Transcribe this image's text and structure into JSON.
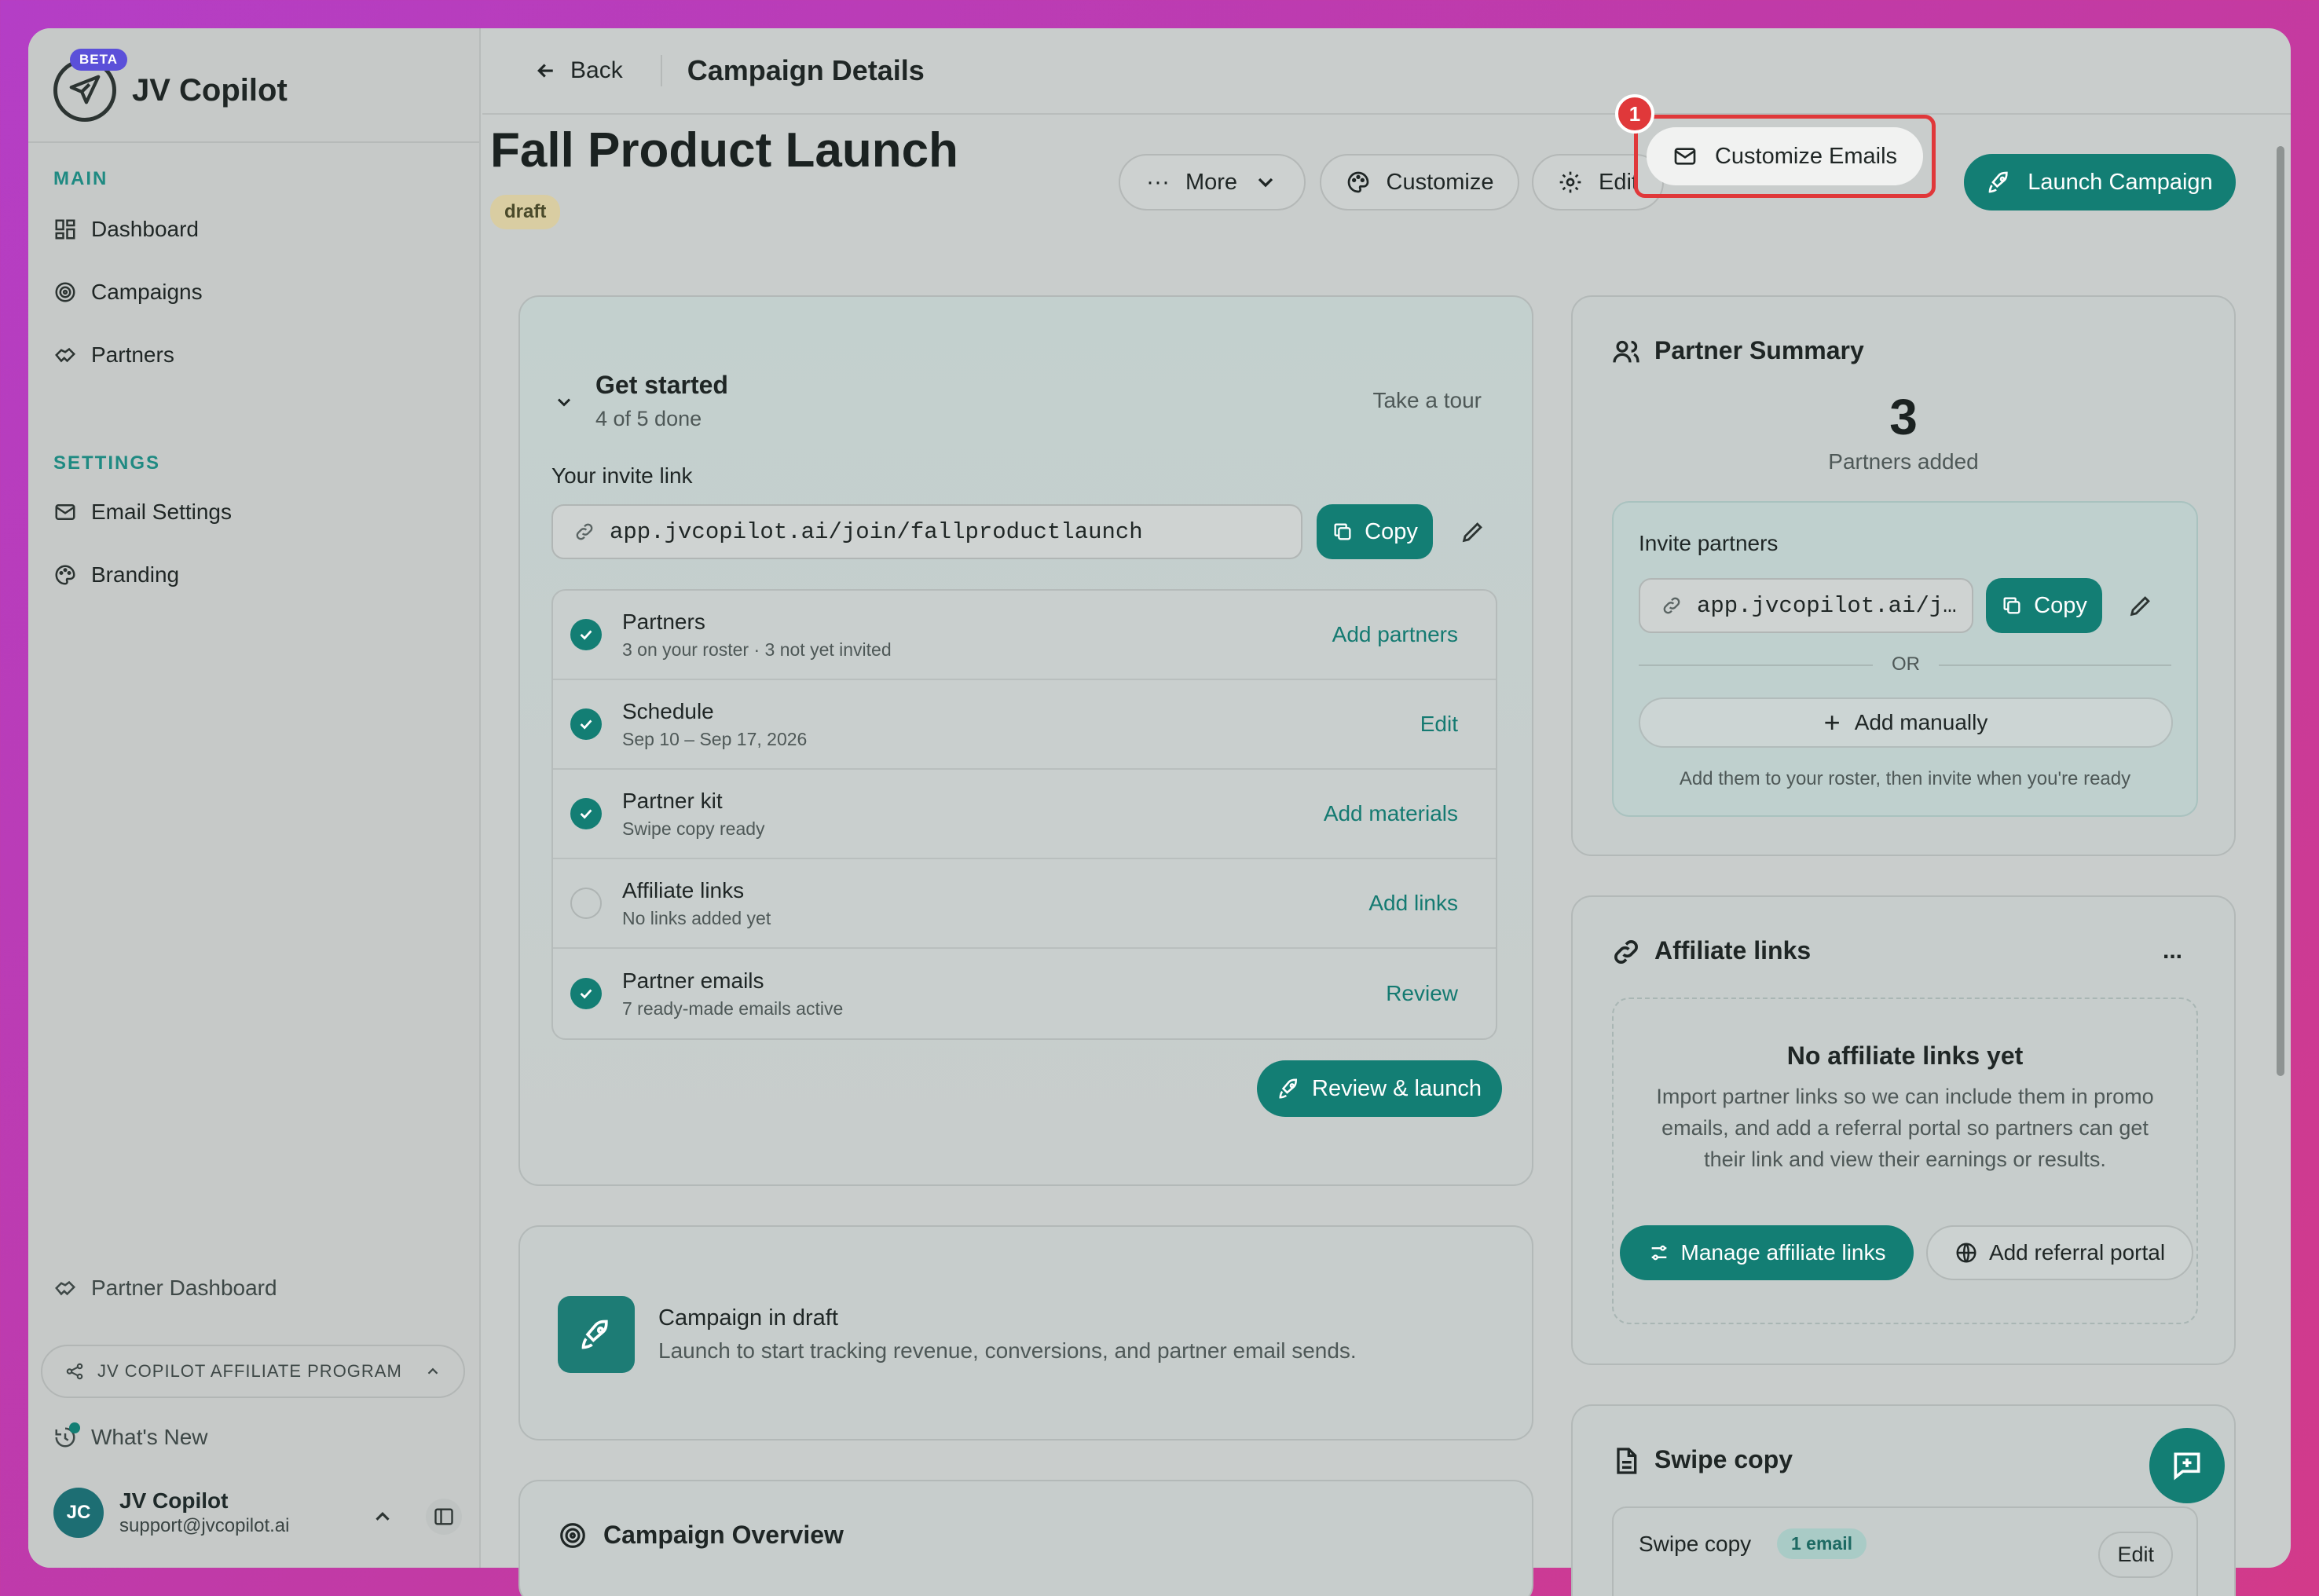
{
  "app": {
    "name": "JV Copilot",
    "beta": "BETA"
  },
  "sidebar": {
    "main_heading": "MAIN",
    "main_items": [
      {
        "label": "Dashboard",
        "icon": "dashboard-icon"
      },
      {
        "label": "Campaigns",
        "icon": "target-icon"
      },
      {
        "label": "Partners",
        "icon": "handshake-icon"
      }
    ],
    "settings_heading": "SETTINGS",
    "settings_items": [
      {
        "label": "Email Settings",
        "icon": "mail-icon"
      },
      {
        "label": "Branding",
        "icon": "palette-icon"
      }
    ],
    "partner_dashboard": "Partner Dashboard",
    "affiliate_program": "JV COPILOT AFFILIATE PROGRAM",
    "whats_new": "What's New",
    "user": {
      "initials": "JC",
      "name": "JV Copilot",
      "email": "support@jvcopilot.ai"
    }
  },
  "topbar": {
    "back": "Back",
    "title": "Campaign Details"
  },
  "campaign": {
    "name": "Fall Product Launch",
    "status": "draft"
  },
  "toolbar": {
    "more": "More",
    "customize": "Customize",
    "edit": "Edit",
    "customize_emails": "Customize Emails",
    "launch": "Launch Campaign",
    "step_badge": "1"
  },
  "get_started": {
    "title": "Get started",
    "progress": "4 of 5 done",
    "tour": "Take a tour",
    "invite_label": "Your invite link",
    "invite_url": "app.jvcopilot.ai/join/fallproductlaunch",
    "copy": "Copy",
    "steps": [
      {
        "title": "Partners",
        "sub": "3 on your roster · 3 not yet invited",
        "action": "Add partners",
        "done": true
      },
      {
        "title": "Schedule",
        "sub": "Sep 10 – Sep 17, 2026",
        "action": "Edit",
        "done": true
      },
      {
        "title": "Partner kit",
        "sub": "Swipe copy ready",
        "action": "Add materials",
        "done": true
      },
      {
        "title": "Affiliate links",
        "sub": "No links added yet",
        "action": "Add links",
        "done": false
      },
      {
        "title": "Partner emails",
        "sub": "7 ready-made emails active",
        "action": "Review",
        "done": true
      }
    ],
    "review_launch": "Review & launch"
  },
  "draft_card": {
    "title": "Campaign in draft",
    "desc": "Launch to start tracking revenue, conversions, and partner email sends."
  },
  "overview": {
    "title": "Campaign Overview"
  },
  "partner_summary": {
    "title": "Partner Summary",
    "count": "3",
    "count_label": "Partners added",
    "invite_title": "Invite partners",
    "invite_url_short": "app.jvcopilot.ai/j…",
    "copy": "Copy",
    "or": "OR",
    "add_manually": "Add manually",
    "hint": "Add them to your roster, then invite when you're ready"
  },
  "affiliate": {
    "title": "Affiliate links",
    "more": "...",
    "empty_title": "No affiliate links yet",
    "empty_desc": "Import partner links so we can include them in promo emails, and add a referral portal so partners can get their link and view their earnings or results.",
    "manage": "Manage affiliate links",
    "add_portal": "Add referral portal"
  },
  "swipe": {
    "title": "Swipe copy",
    "row_label": "Swipe copy",
    "badge": "1 email",
    "edit": "Edit"
  }
}
